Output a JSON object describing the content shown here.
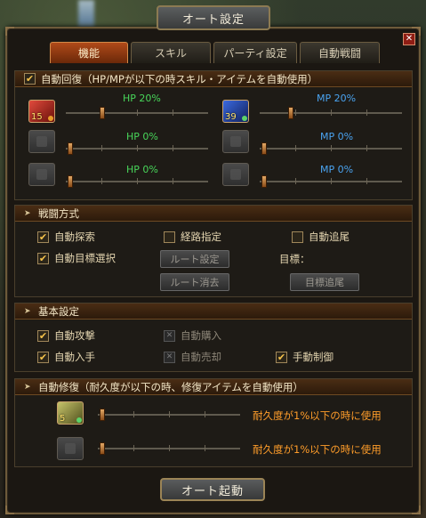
{
  "window": {
    "title": "オート設定",
    "close_glyph": "✕"
  },
  "tabs": [
    {
      "label": "機能",
      "active": true
    },
    {
      "label": "スキル",
      "active": false
    },
    {
      "label": "パーティ設定",
      "active": false
    },
    {
      "label": "自動戦闘",
      "active": false
    }
  ],
  "auto_recovery": {
    "header": "自動回復（HP/MPが以下の時スキル・アイテムを自動使用）",
    "checked": true,
    "rows": [
      {
        "hp_qty": "15",
        "hp_value": "HP 20%",
        "hp_fraction": 0.2,
        "mp_qty": "39",
        "mp_value": "MP 20%",
        "mp_fraction": 0.2
      },
      {
        "hp_qty": "",
        "hp_value": "HP 0%",
        "hp_fraction": 0,
        "mp_qty": "",
        "mp_value": "MP 0%",
        "mp_fraction": 0
      },
      {
        "hp_qty": "",
        "hp_value": "HP 0%",
        "hp_fraction": 0,
        "mp_qty": "",
        "mp_value": "MP 0%",
        "mp_fraction": 0
      }
    ]
  },
  "combat": {
    "header": "戦闘方式",
    "auto_search": "自動探索",
    "route": "経路指定",
    "auto_follow": "自動追尾",
    "auto_target": "自動目標選択",
    "route_set": "ルート設定",
    "route_clear": "ルート消去",
    "target_label": "目標：",
    "target_follow": "目標追尾"
  },
  "basic": {
    "header": "基本設定",
    "auto_attack": "自動攻撃",
    "auto_buy": "自動購入",
    "auto_loot": "自動入手",
    "auto_sell": "自動売却",
    "manual_control": "手動制御"
  },
  "repair": {
    "header": "自動修復（耐久度が以下の時、修復アイテムを自動使用）",
    "rows": [
      {
        "qty": "5",
        "text": "耐久度が1%以下の時に使用",
        "fraction": 0.01
      },
      {
        "qty": "",
        "text": "耐久度が1%以下の時に使用",
        "fraction": 0.01
      }
    ]
  },
  "start_button": "オート起動",
  "colors": {
    "accent": "#ff9d2a",
    "hp": "#48d65a",
    "mp": "#4aa3f0",
    "check": "#f5c24a"
  }
}
